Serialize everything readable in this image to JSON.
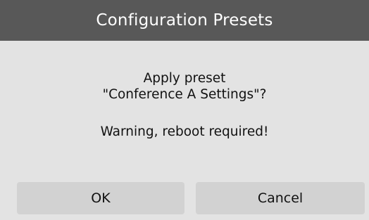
{
  "dialog": {
    "title": "Configuration Presets",
    "message_line1": "Apply preset",
    "message_line2": "\"Conference A Settings\"?",
    "warning": "Warning, reboot required!",
    "ok_label": "OK",
    "cancel_label": "Cancel"
  },
  "colors": {
    "titlebar": "#585858",
    "background": "#e3e3e3",
    "button": "#d2d2d2"
  }
}
